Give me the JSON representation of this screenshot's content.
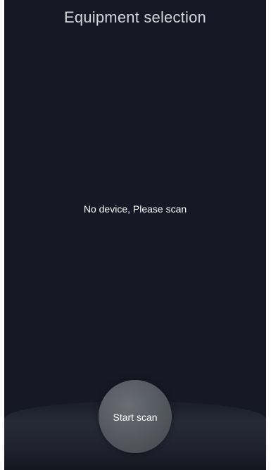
{
  "header": {
    "title": "Equipment selection"
  },
  "device_list": {
    "empty_message": "No device, Please scan"
  },
  "actions": {
    "scan_label": "Start scan"
  },
  "colors": {
    "background": "#161825",
    "title_text": "#d4d5da",
    "button": "#5b5e66"
  }
}
